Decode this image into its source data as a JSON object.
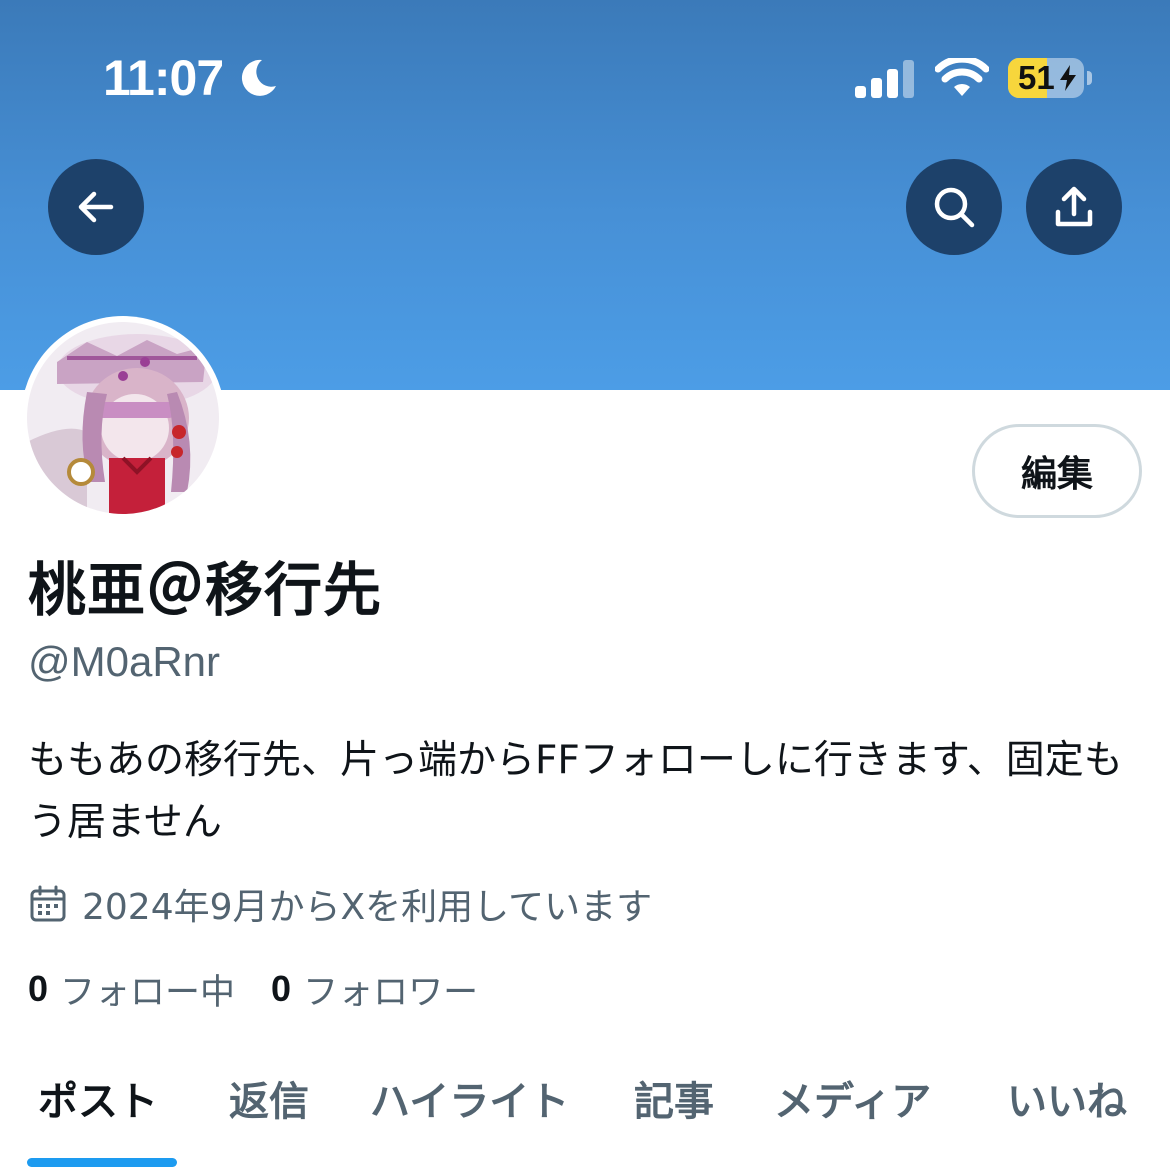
{
  "status_bar": {
    "time": "11:07",
    "battery_level": "51",
    "battery_fraction": 0.51,
    "icons": [
      "moon-icon",
      "cellular-signal-icon",
      "wifi-icon",
      "battery-charging-icon"
    ]
  },
  "header": {
    "back_icon": "arrow-left-icon",
    "search_icon": "search-icon",
    "share_icon": "share-upload-icon",
    "banner_color": "#4790d6"
  },
  "profile": {
    "edit_label": "編集",
    "display_name": "桃亜＠移行先",
    "handle": "@M0aRnr",
    "bio": "ももあの移行先、片っ端からFFフォローしに行きます、固定もう居ません",
    "joined_icon": "calendar-icon",
    "joined": "2024年9月からXを利用しています",
    "following_count": "0",
    "following_label": "フォロー中",
    "followers_count": "0",
    "followers_label": "フォロワー"
  },
  "tabs": [
    {
      "label": "ポスト",
      "active": true
    },
    {
      "label": "返信",
      "active": false
    },
    {
      "label": "ハイライト",
      "active": false
    },
    {
      "label": "記事",
      "active": false
    },
    {
      "label": "メディア",
      "active": false
    },
    {
      "label": "いいね",
      "active": false
    }
  ],
  "colors": {
    "accent": "#1d9bf0",
    "nav_button": "#1d416a",
    "secondary_text": "#536471",
    "battery": "#f7d63c"
  }
}
